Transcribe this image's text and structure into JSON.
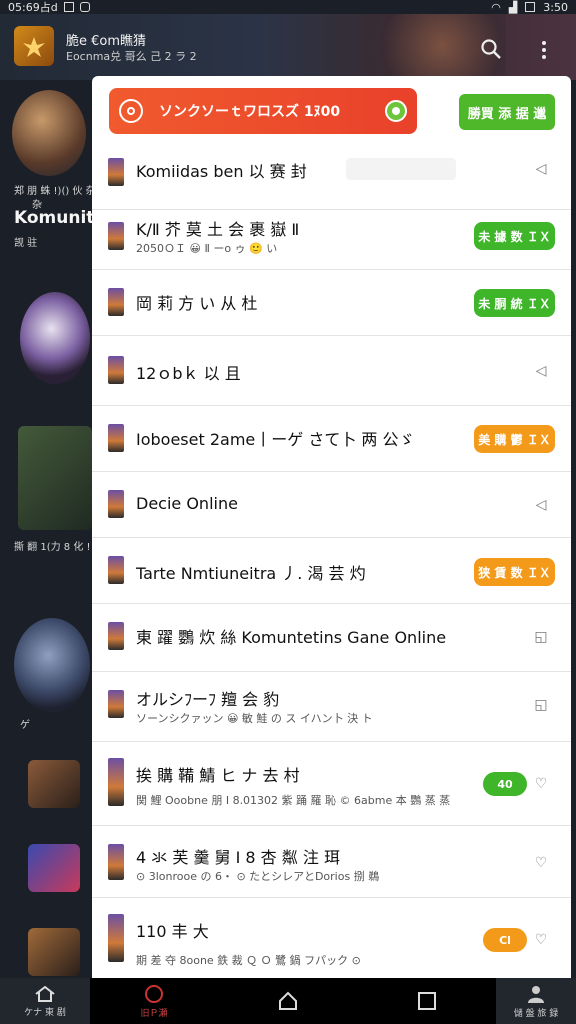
{
  "status_bar": {
    "left_text": "05:69占d",
    "right_text": "3:50"
  },
  "header": {
    "title": "脆e €om瞧猜",
    "subtitle": "Eocnma兑 哥么 己 2 ラ 2"
  },
  "background": {
    "item1_line1": "郑 朋 蛛 !)() 伙 杂 钞",
    "item1_line2": "杂",
    "item1_title": "Komunit",
    "item1_line3": "觊 驻",
    "item2_line1": "撕 翻 1(力 8 化 ! 韵",
    "item3_text": "ゲ"
  },
  "popup": {
    "promo_text": "ソンクソーｔワロスズ 1ﾇ00",
    "top_button": "勝買 添 据 邋",
    "rows": [
      {
        "title": "Komiidas ben 以 赛 封"
      },
      {
        "title": "K/Ⅱ 芥 莫 土 会 裹 嶽 Ⅱ",
        "sub": "2050ＯＩ 😀 Ⅱ ーo ゥ 🙂 い",
        "button": "未 據 数 ＩＸ"
      },
      {
        "title": "岡 莉 方 い 从 杜",
        "button": "未 胴 統 ＩＸ"
      },
      {
        "title": "12ｏbｋ 以 且"
      },
      {
        "title": "Ioboeset 2ame丨ーゲ さて卜 两 公ゞ",
        "button": "美 購 鬱 ＩＸ"
      },
      {
        "title": "Decie Online"
      },
      {
        "title": "Tarte Nmtiuneitra 丿. 渴 芸 灼",
        "button": "狭 賃 数 ＩＸ"
      },
      {
        "title": "東 躍 鸚 炊 絲  Komuntetins Gane Online"
      },
      {
        "title": "オルシﾌーﾌ 羶 会 豹",
        "sub": "ソーンシクァッン 😀 敏 鮭 の ス イハン卜 決 ト"
      },
      {
        "title": "挨 購 鞴 鯖 ヒ ナ 去 村",
        "sub": "関 鯉 Ooobne 朋 Ⅰ 8.01302 紫 踊 羅 恥 © 6abme 本 鸚 蒸 蒸",
        "pill": "40"
      },
      {
        "title": "4 氺 芙 羹 舅 Ⅰ 8 杏 粼 注 珥",
        "sub": "⊙ 3lonrooe の 6・ ⊙ たとシレアとDorios 捌 鵜"
      },
      {
        "title": "110 丰 大",
        "sub": "期 差 夺 8oone 鉄 裁 Ｑ Ｏ  鷺 鍋 フパック ⊙",
        "pill": "Cl"
      }
    ]
  },
  "navbar": {
    "left_label": "ケナ 東 剧",
    "mid_label": "旧Ｐ瀬",
    "right_label": "儲 盤 旅 録"
  },
  "colors": {
    "promo": "#e9412b",
    "green": "#3fb52a",
    "orange": "#f49a1a"
  }
}
